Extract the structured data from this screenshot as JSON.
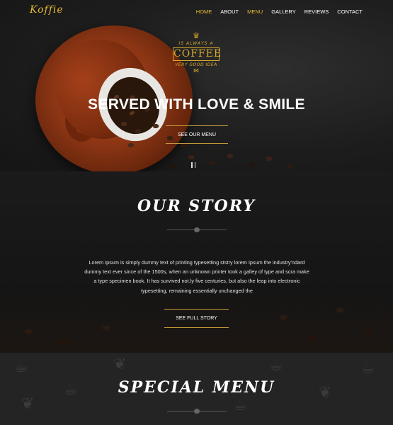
{
  "brand": {
    "logo": "Koffie"
  },
  "nav": {
    "items": [
      {
        "label": "HOME",
        "active": true
      },
      {
        "label": "ABOUT",
        "active": false
      },
      {
        "label": "MENU",
        "active": true
      },
      {
        "label": "GALLERY",
        "active": false
      },
      {
        "label": "REVIEWS",
        "active": false
      },
      {
        "label": "CONTACT",
        "active": false
      }
    ]
  },
  "hero": {
    "badge": {
      "line1": "IS ALWAYS A",
      "brand": "COFFEE",
      "line2": "VERY GOOD IDEA"
    },
    "title": "SERVED WITH LOVE & SMILE",
    "button": "SEE OUR MENU"
  },
  "story": {
    "title": "OUR STORY",
    "text": "Lorem Ipsum is simply dummy text of printing typesetting ststry lorem Ipsum the industry'ndard dummy text ever since of the 1500s, when an unknown printer took a galley of type and scra make a type specimen book. It has survived not.ly five centuries, but also the leap into electronic typesetting, remaining essentially unchanged the",
    "button": "SEE FULL STORY"
  },
  "menu": {
    "title": "SPECIAL MENU"
  },
  "colors": {
    "accent": "#e3b83a",
    "background": "#141414"
  }
}
